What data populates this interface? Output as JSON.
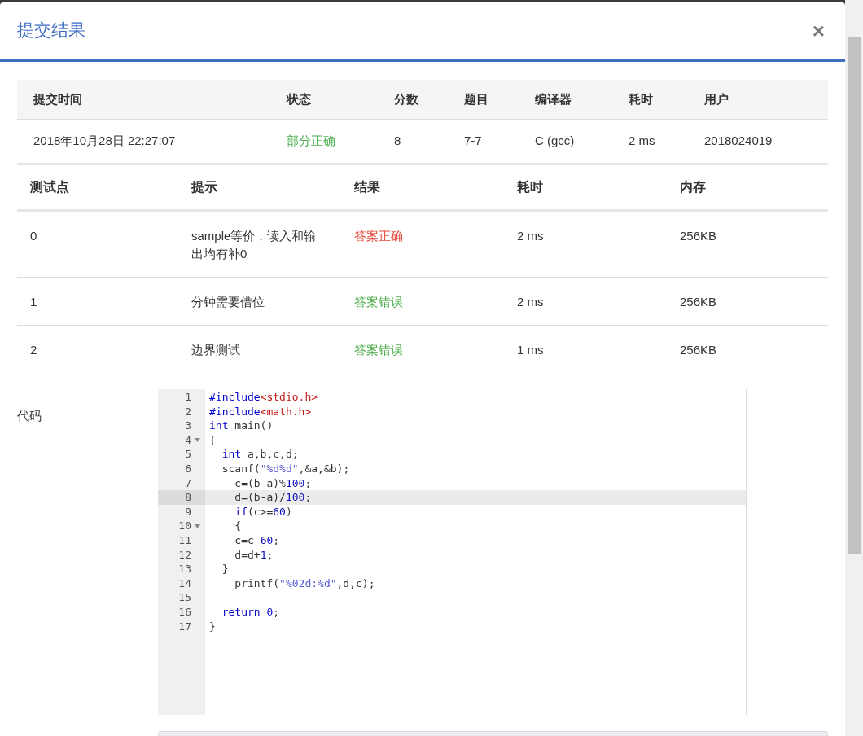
{
  "dialog": {
    "title": "提交结果",
    "close": "×"
  },
  "summary": {
    "columns": [
      "提交时间",
      "状态",
      "分数",
      "题目",
      "编译器",
      "耗时",
      "用户"
    ],
    "row": {
      "time": "2018年10月28日 22:27:07",
      "status": "部分正确",
      "score": "8",
      "problem": "7-7",
      "compiler": "C (gcc)",
      "duration": "2 ms",
      "user": "2018024019"
    }
  },
  "tests": {
    "columns": [
      "测试点",
      "提示",
      "结果",
      "耗时",
      "内存"
    ],
    "rows": [
      {
        "case": "0",
        "hint": "sample等价，读入和输出均有补0",
        "result": "答案正确",
        "color": "#e74c3c",
        "duration": "2 ms",
        "memory": "256KB"
      },
      {
        "case": "1",
        "hint": "分钟需要借位",
        "result": "答案错误",
        "color": "#4cae4c",
        "duration": "2 ms",
        "memory": "256KB"
      },
      {
        "case": "2",
        "hint": "边界测试",
        "result": "答案错误",
        "color": "#4cae4c",
        "duration": "1 ms",
        "memory": "256KB"
      }
    ]
  },
  "code": {
    "label": "代码",
    "lines": [
      {
        "number": "1",
        "foldable": false,
        "active": false,
        "tokens": [
          {
            "kind": "keyword",
            "text": "#include"
          },
          {
            "kind": "header",
            "text": "<stdio.h>"
          }
        ]
      },
      {
        "number": "2",
        "foldable": false,
        "active": false,
        "tokens": [
          {
            "kind": "keyword",
            "text": "#include"
          },
          {
            "kind": "header",
            "text": "<math.h>"
          }
        ]
      },
      {
        "number": "3",
        "foldable": false,
        "active": false,
        "tokens": [
          {
            "kind": "keyword",
            "text": "int"
          },
          {
            "kind": "plain",
            "text": " main()"
          }
        ]
      },
      {
        "number": "4",
        "foldable": true,
        "active": false,
        "tokens": [
          {
            "kind": "plain",
            "text": "{"
          }
        ]
      },
      {
        "number": "5",
        "foldable": false,
        "active": false,
        "tokens": [
          {
            "kind": "keyword",
            "text": "  int"
          },
          {
            "kind": "plain",
            "text": " a,b,c,d;"
          }
        ]
      },
      {
        "number": "6",
        "foldable": false,
        "active": false,
        "tokens": [
          {
            "kind": "plain",
            "text": "  scanf("
          },
          {
            "kind": "string",
            "text": "\"%d%d\""
          },
          {
            "kind": "plain",
            "text": ",&a,&b);"
          }
        ]
      },
      {
        "number": "7",
        "foldable": false,
        "active": false,
        "tokens": [
          {
            "kind": "plain",
            "text": "    c=(b-a)%"
          },
          {
            "kind": "number",
            "text": "100"
          },
          {
            "kind": "plain",
            "text": ";"
          }
        ]
      },
      {
        "number": "8",
        "foldable": false,
        "active": true,
        "tokens": [
          {
            "kind": "plain",
            "text": "    d=(b-a)/"
          },
          {
            "kind": "number",
            "text": "100"
          },
          {
            "kind": "plain",
            "text": ";"
          }
        ]
      },
      {
        "number": "9",
        "foldable": false,
        "active": false,
        "tokens": [
          {
            "kind": "keyword",
            "text": "    if"
          },
          {
            "kind": "plain",
            "text": "(c>="
          },
          {
            "kind": "number",
            "text": "60"
          },
          {
            "kind": "plain",
            "text": ")"
          }
        ]
      },
      {
        "number": "10",
        "foldable": true,
        "active": false,
        "tokens": [
          {
            "kind": "plain",
            "text": "    {"
          }
        ]
      },
      {
        "number": "11",
        "foldable": false,
        "active": false,
        "tokens": [
          {
            "kind": "plain",
            "text": "    c=c-"
          },
          {
            "kind": "number",
            "text": "60"
          },
          {
            "kind": "plain",
            "text": ";"
          }
        ]
      },
      {
        "number": "12",
        "foldable": false,
        "active": false,
        "tokens": [
          {
            "kind": "plain",
            "text": "    d=d+"
          },
          {
            "kind": "number",
            "text": "1"
          },
          {
            "kind": "plain",
            "text": ";"
          }
        ]
      },
      {
        "number": "13",
        "foldable": false,
        "active": false,
        "tokens": [
          {
            "kind": "plain",
            "text": "  }"
          }
        ]
      },
      {
        "number": "14",
        "foldable": false,
        "active": false,
        "tokens": [
          {
            "kind": "plain",
            "text": "    printf("
          },
          {
            "kind": "string",
            "text": "\"%02d:%d\""
          },
          {
            "kind": "plain",
            "text": ",d,c);"
          }
        ]
      },
      {
        "number": "15",
        "foldable": false,
        "active": false
      },
      {
        "number": "16",
        "foldable": false,
        "active": false,
        "tokens": [
          {
            "kind": "keyword",
            "text": "  return"
          },
          {
            "kind": "number",
            "text": " 0"
          },
          {
            "kind": "plain",
            "text": ";"
          }
        ]
      },
      {
        "number": "17",
        "foldable": false,
        "active": false,
        "tokens": [
          {
            "kind": "plain",
            "text": "}"
          }
        ]
      }
    ]
  }
}
